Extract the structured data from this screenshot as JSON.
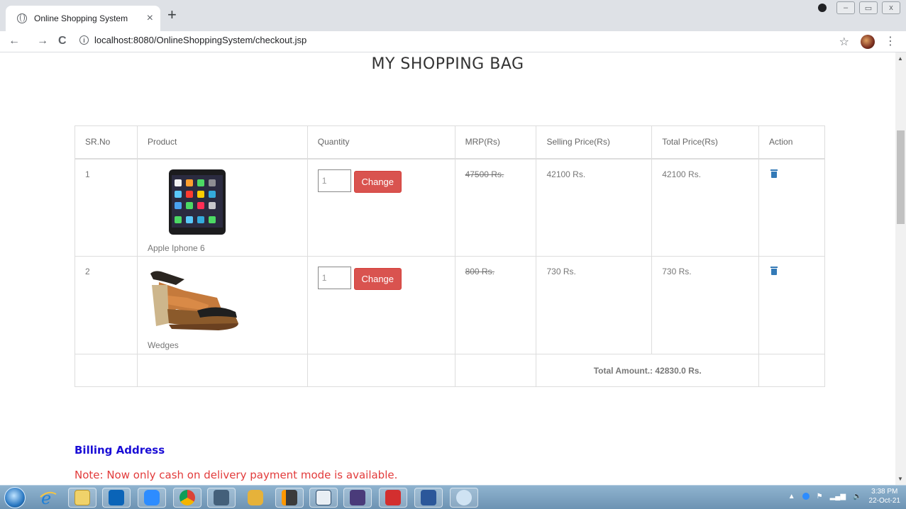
{
  "browser": {
    "tab_title": "Online Shopping System",
    "tab_close": "×",
    "new_tab": "+",
    "url": "localhost:8080/OnlineShoppingSystem/checkout.jsp",
    "back": "←",
    "forward": "→",
    "reload": "C",
    "info": "i",
    "star": "☆",
    "menu": "⋮",
    "win_min": "–",
    "win_max": "▭",
    "win_close": "x"
  },
  "page": {
    "title": "MY SHOPPING BAG",
    "columns": [
      "SR.No",
      "Product",
      "Quantity",
      "MRP(Rs)",
      "Selling Price(Rs)",
      "Total Price(Rs)",
      "Action"
    ],
    "items": [
      {
        "sr": "1",
        "name": "Apple Iphone 6",
        "qty": "1",
        "mrp": "47500 Rs.",
        "selling": "42100 Rs.",
        "total": "42100 Rs.",
        "change_label": "Change"
      },
      {
        "sr": "2",
        "name": "Wedges",
        "qty": "1",
        "mrp": "800 Rs.",
        "selling": "730 Rs.",
        "total": "730 Rs.",
        "change_label": "Change"
      }
    ],
    "total_amount": "Total Amount.: 42830.0 Rs.",
    "billing_heading": "Billing Address",
    "note": "Note: Now only cash on delivery payment mode is available."
  },
  "taskbar": {
    "time": "3:38 PM",
    "date": "22-Oct-21",
    "apps": [
      "internet-explorer",
      "file-explorer",
      "outlook",
      "zoom",
      "chrome",
      "mysql-workbench",
      "lock-app",
      "sublime-text",
      "window-app",
      "java-ee-ide",
      "acrobat",
      "word",
      "paint"
    ]
  },
  "colors": {
    "change_button": "#d9534f",
    "trash_icon": "#337ab7",
    "billing_heading": "#1a0dd6",
    "note": "#e23b3b"
  }
}
